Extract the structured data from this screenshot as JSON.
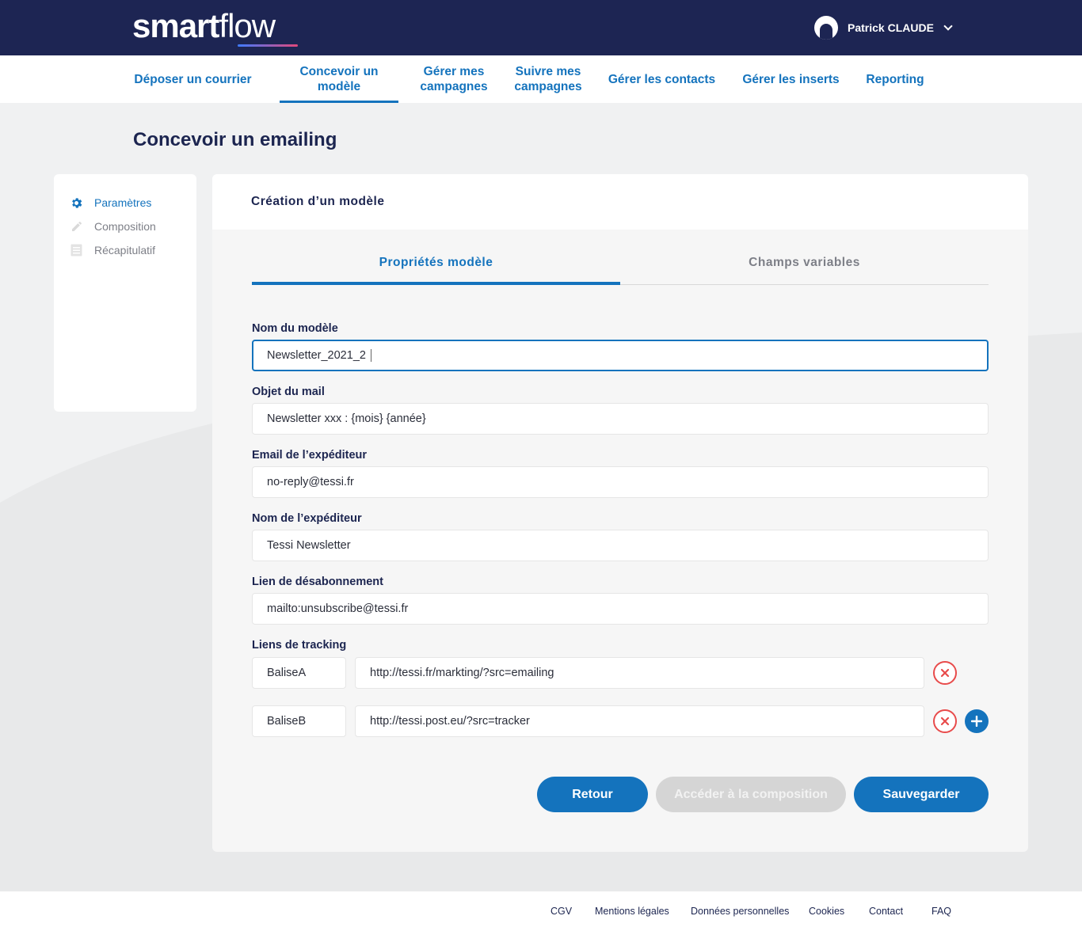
{
  "header": {
    "logo_bold": "smart",
    "logo_light": "flow",
    "user_name": "Patrick CLAUDE"
  },
  "nav": {
    "items": [
      {
        "label": "Déposer un courrier",
        "active": false
      },
      {
        "label": "Concevoir un modèle",
        "active": true
      },
      {
        "label": "Gérer mes campagnes",
        "active": false
      },
      {
        "label": "Suivre mes campagnes",
        "active": false
      },
      {
        "label": "Gérer les contacts",
        "active": false
      },
      {
        "label": "Gérer les inserts",
        "active": false
      },
      {
        "label": "Reporting",
        "active": false
      }
    ]
  },
  "page": {
    "title": "Concevoir un emailing"
  },
  "sidebar": {
    "steps": [
      {
        "label": "Paramètres",
        "icon": "gear-icon",
        "active": true
      },
      {
        "label": "Composition",
        "icon": "pencil-icon",
        "active": false
      },
      {
        "label": "Récapitulatif",
        "icon": "list-icon",
        "active": false
      }
    ]
  },
  "card": {
    "title": "Création d’un modèle",
    "tabs": [
      {
        "label": "Propriétés modèle",
        "active": true
      },
      {
        "label": "Champs variables",
        "active": false
      }
    ]
  },
  "form": {
    "model_name": {
      "label": "Nom du modèle",
      "value": "Newsletter_2021_2"
    },
    "mail_subject": {
      "label": "Objet du mail",
      "value": "Newsletter xxx : {mois} {année}"
    },
    "sender_email": {
      "label": "Email de l’expéditeur",
      "value": "no-reply@tessi.fr"
    },
    "sender_name": {
      "label": "Nom de l’expéditeur",
      "value": "Tessi Newsletter"
    },
    "unsubscribe_link": {
      "label": "Lien de désabonnement",
      "value": "mailto:unsubscribe@tessi.fr"
    },
    "tracking": {
      "label": "Liens de tracking",
      "rows": [
        {
          "tag": "BaliseA",
          "url": "http://tessi.fr/markting/?src=emailing"
        },
        {
          "tag": "BaliseB",
          "url": "http://tessi.post.eu/?src=tracker"
        }
      ]
    }
  },
  "actions": {
    "back": "Retour",
    "composition": "Accéder à la composition",
    "save": "Sauvegarder"
  },
  "footer": {
    "links": [
      "CGV",
      "Mentions légales",
      "Données personnelles",
      "Cookies",
      "Contact",
      "FAQ"
    ]
  },
  "colors": {
    "header_bg": "#1d2553",
    "accent": "#1473bd",
    "danger": "#e84b4b",
    "page_bg": "#f0f1f2"
  }
}
